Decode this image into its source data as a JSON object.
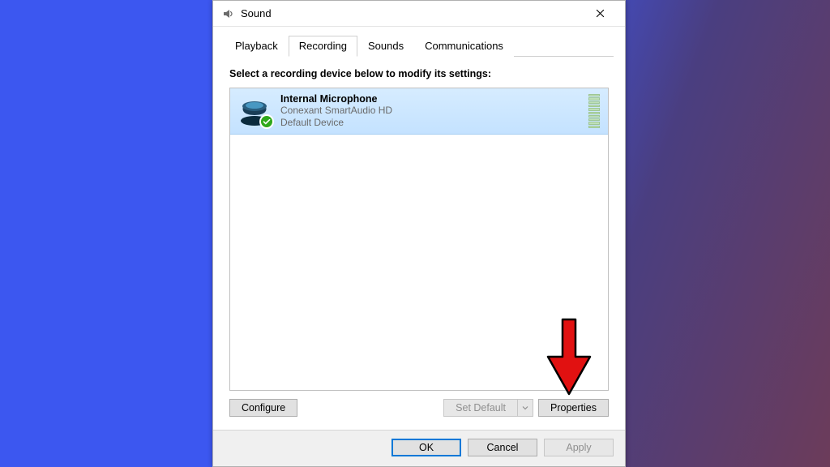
{
  "window": {
    "title": "Sound",
    "close_label": "Close"
  },
  "tabs": {
    "playback": "Playback",
    "recording": "Recording",
    "sounds": "Sounds",
    "communications": "Communications",
    "active": "recording"
  },
  "recording": {
    "instruction": "Select a recording device below to modify its settings:",
    "devices": [
      {
        "name": "Internal Microphone",
        "driver": "Conexant SmartAudio HD",
        "status": "Default Device",
        "selected": true,
        "default_badge": true,
        "level_bars": 10
      }
    ],
    "buttons": {
      "configure": "Configure",
      "set_default": "Set Default",
      "properties": "Properties"
    },
    "set_default_enabled": false
  },
  "dialog": {
    "ok": "OK",
    "cancel": "Cancel",
    "apply": "Apply",
    "apply_enabled": false
  },
  "annotation": {
    "arrow_target": "properties-button"
  }
}
